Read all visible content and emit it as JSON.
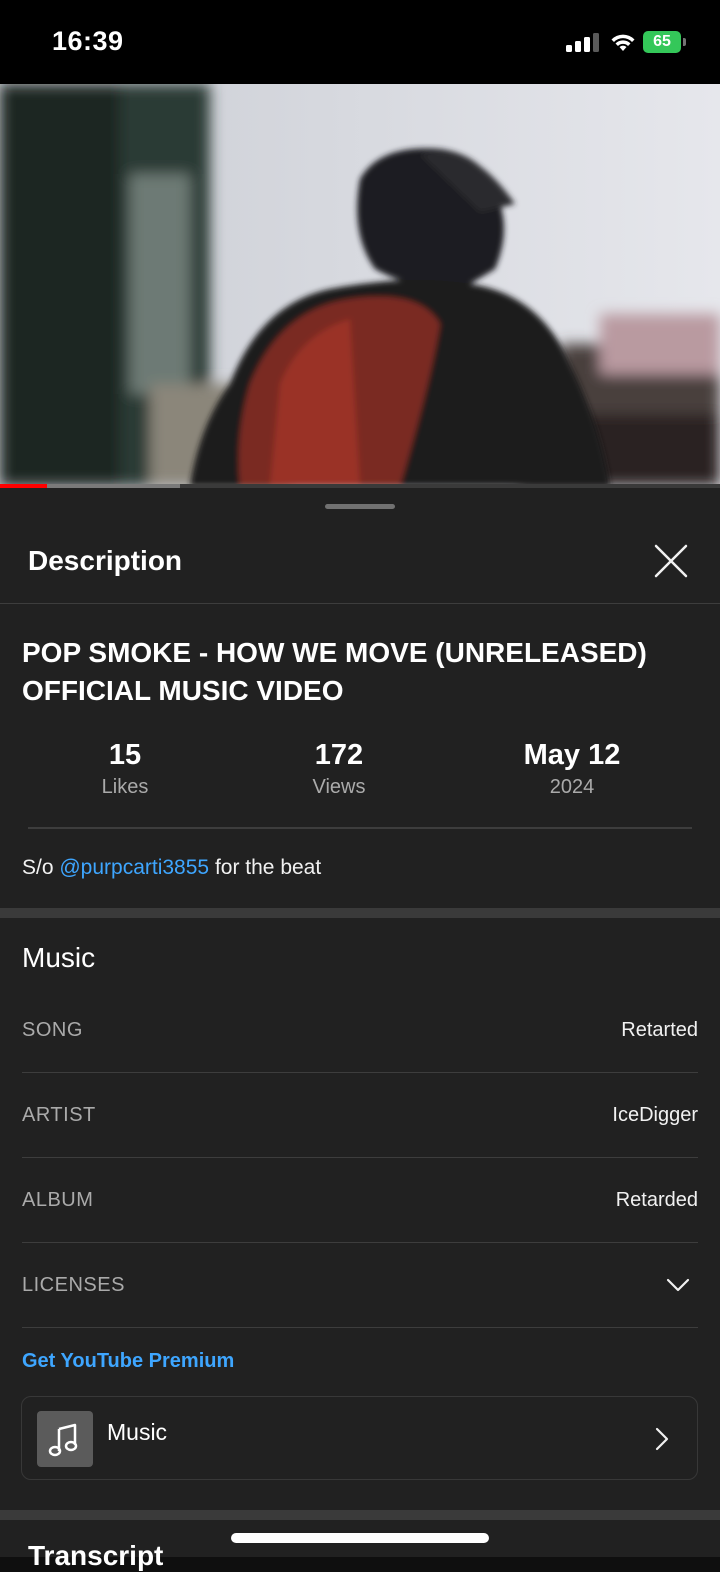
{
  "status_bar": {
    "time": "16:39",
    "battery_level": "65",
    "battery_color": "#34c759",
    "icons": [
      "cellular-signal-icon",
      "wifi-icon",
      "battery-charging-icon"
    ]
  },
  "player": {
    "progress_played_fraction": 0.065,
    "progress_buffered_fraction": 0.25,
    "progress_color": "#ff0000"
  },
  "description_panel": {
    "header_title": "Description",
    "close_icon": "close-icon",
    "video_title": "POP SMOKE - HOW WE MOVE (UNRELEASED) OFFICIAL MUSIC VIDEO",
    "stats": [
      {
        "value": "15",
        "label": "Likes"
      },
      {
        "value": "172",
        "label": "Views"
      },
      {
        "value": "May 12",
        "label": "2024"
      }
    ],
    "description": {
      "prefix": "S/o ",
      "mention": "@purpcarti3855",
      "suffix": " for the beat"
    },
    "link_color": "#3ea6ff"
  },
  "music": {
    "heading": "Music",
    "rows": [
      {
        "key": "SONG",
        "value": "Retarted"
      },
      {
        "key": "ARTIST",
        "value": "IceDigger"
      },
      {
        "key": "ALBUM",
        "value": "Retarded"
      },
      {
        "key": "LICENSES",
        "value": ""
      }
    ],
    "premium_link": "Get YouTube Premium",
    "card_label": "Music",
    "card_icon": "music-note-icon"
  },
  "transcript": {
    "heading": "Transcript"
  }
}
